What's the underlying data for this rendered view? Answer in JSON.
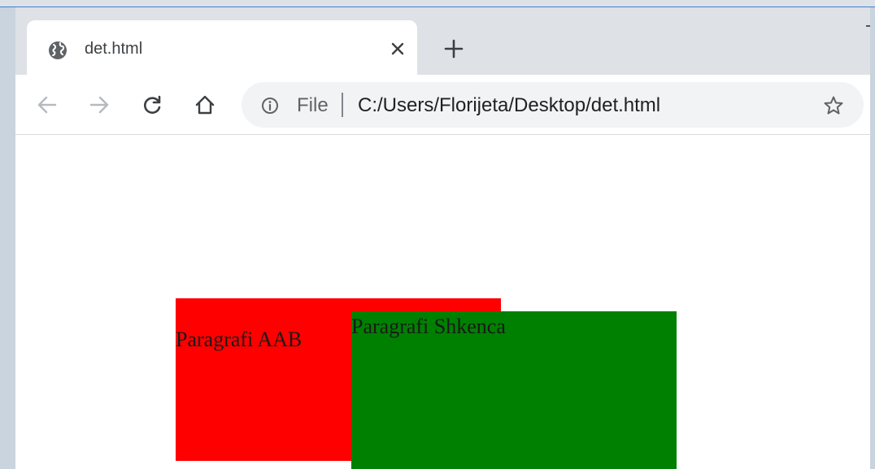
{
  "browser": {
    "tab": {
      "title": "det.html",
      "icon": "globe-icon"
    },
    "toolbar": {
      "scheme_label": "File",
      "url": "C:/Users/Florijeta/Desktop/det.html"
    }
  },
  "page": {
    "boxes": [
      {
        "text": "Paragrafi AAB",
        "color": "#ff0000"
      },
      {
        "text": "Paragrafi Shkenca",
        "color": "#008000"
      }
    ]
  }
}
